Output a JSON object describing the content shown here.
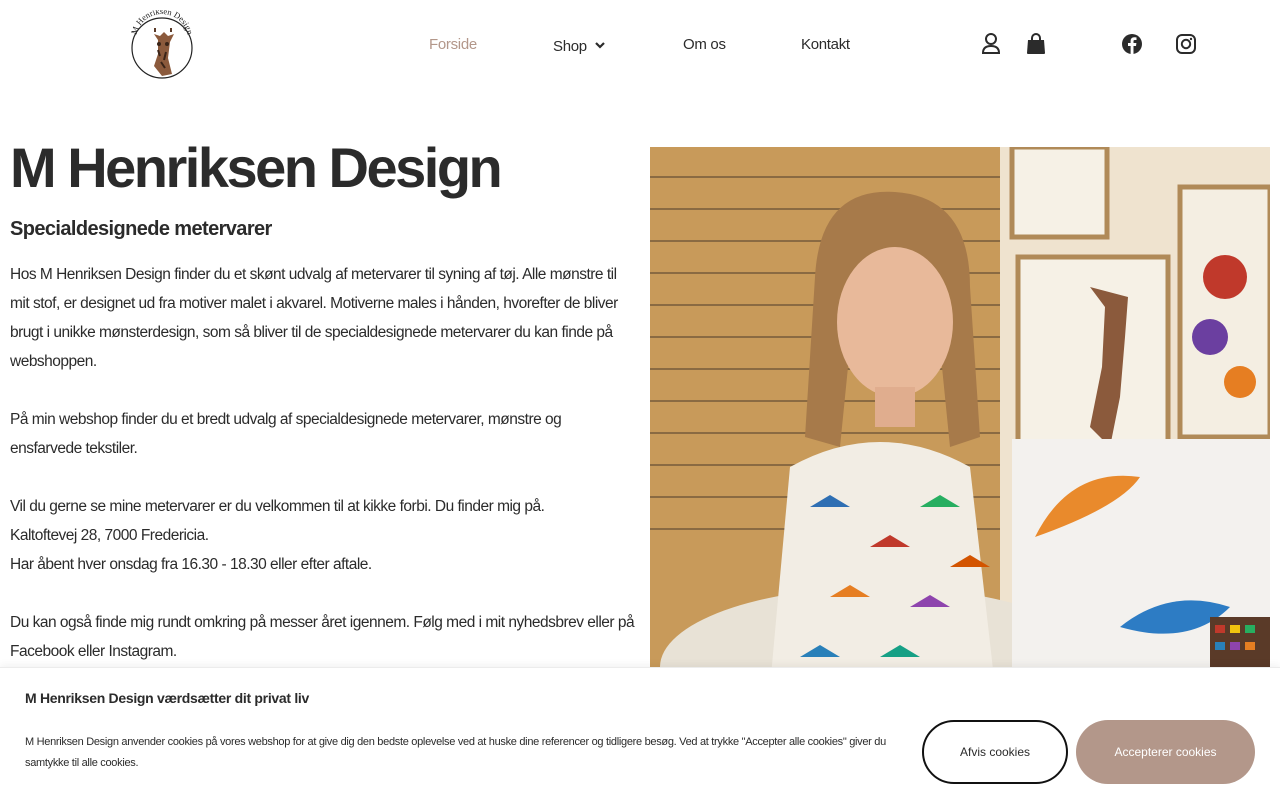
{
  "header": {
    "logo_text": "M Henriksen Design",
    "nav": [
      {
        "label": "Forside",
        "active": true
      },
      {
        "label": "Shop",
        "active": false,
        "has_dropdown": true
      },
      {
        "label": "Om os",
        "active": false
      },
      {
        "label": "Kontakt",
        "active": false
      }
    ],
    "icons": [
      "user-icon",
      "shopping-bag-icon",
      "facebook-icon",
      "instagram-icon"
    ]
  },
  "main": {
    "title": "M Henriksen Design",
    "subtitle": "Specialdesignede metervarer",
    "paragraphs": [
      "Hos M Henriksen Design finder du et skønt udvalg af metervarer til syning af tøj. Alle mønstre til mit stof, er designet ud fra motiver malet i akvarel. Motiverne males i hånden, hvorefter de bliver brugt i unikke mønsterdesign, som så bliver til de specialdesignede metervarer du kan finde på webshoppen.",
      "På min webshop finder du et bredt udvalg af specialdesignede metervarer, mønstre og ensfarvede tekstiler.",
      "Vil du gerne se mine metervarer er du velkommen til at kikke forbi. Du finder mig på.",
      "Kaltoftevej 28, 7000 Fredericia.",
      "Har åbent hver onsdag fra 16.30 - 18.30 eller efter aftale.",
      "Du kan også finde mig rundt omkring på messer året igennem. Følg med i mit nyhedsbrev eller på Facebook eller Instagram."
    ]
  },
  "cookie": {
    "title": "M Henriksen Design værdsætter dit privat liv",
    "text": "M Henriksen Design anvender cookies på vores webshop for at give dig den bedste oplevelse ved at huske dine referencer og tidligere besøg. Ved at trykke \"Accepter alle cookies\" giver du samtykke til alle cookies.",
    "reject_label": "Afvis cookies",
    "accept_label": "Accepterer cookies"
  },
  "colors": {
    "accent": "#b3978a",
    "text": "#2b2b2b"
  }
}
